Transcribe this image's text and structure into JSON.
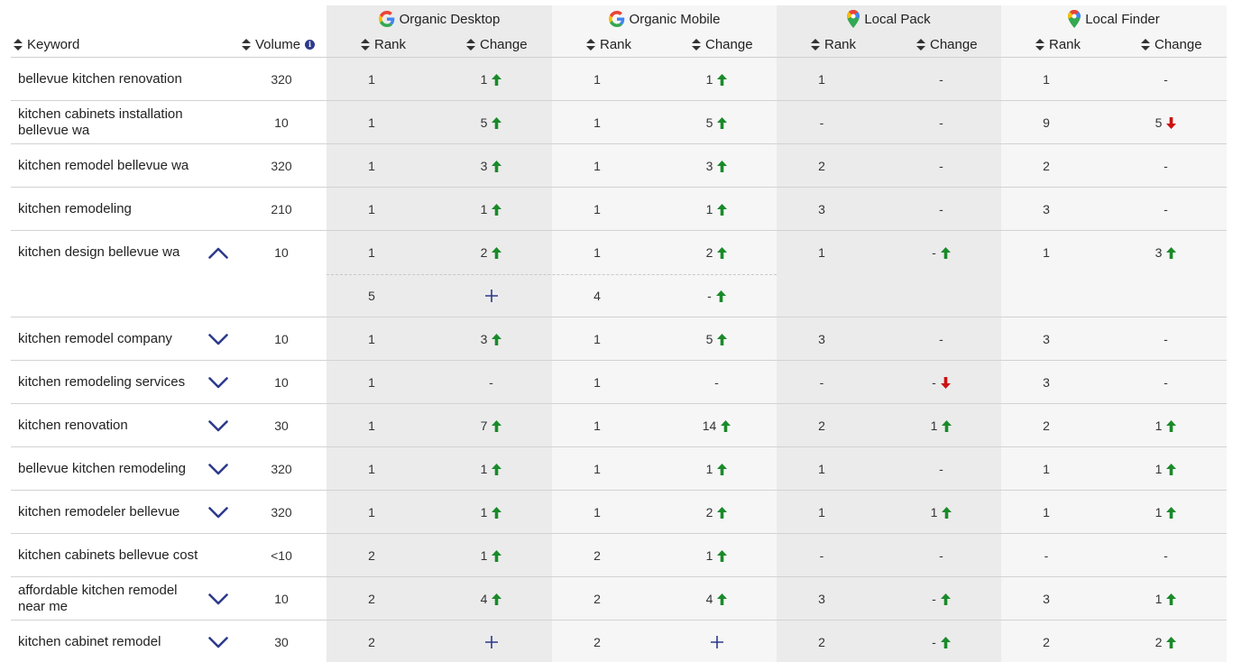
{
  "groups": {
    "organic_desktop": "Organic Desktop",
    "organic_mobile": "Organic Mobile",
    "local_pack": "Local Pack",
    "local_finder": "Local Finder"
  },
  "columns": {
    "keyword": "Keyword",
    "volume": "Volume",
    "rank": "Rank",
    "change": "Change"
  },
  "colors": {
    "up": "#1a8a2a",
    "down": "#cc1111",
    "accent": "#2d3a8c"
  },
  "icons": {
    "sort": "sort-icon",
    "info": "info-icon",
    "google": "google-icon",
    "maps_pin": "maps-pin-icon",
    "chevron_up": "chevron-up-icon",
    "chevron_down": "chevron-down-icon",
    "arrow_up": "arrow-up-icon",
    "arrow_down": "arrow-down-icon",
    "plus": "plus-icon"
  },
  "rows": [
    {
      "keyword": "bellevue kitchen renovation",
      "expander": "",
      "volume": "320",
      "od_rank": "1",
      "od_change": "1",
      "od_dir": "up",
      "om_rank": "1",
      "om_change": "1",
      "om_dir": "up",
      "lp_rank": "1",
      "lp_change": "-",
      "lp_dir": "",
      "lf_rank": "1",
      "lf_change": "-",
      "lf_dir": ""
    },
    {
      "keyword": "kitchen cabinets installation bellevue wa",
      "expander": "",
      "volume": "10",
      "od_rank": "1",
      "od_change": "5",
      "od_dir": "up",
      "om_rank": "1",
      "om_change": "5",
      "om_dir": "up",
      "lp_rank": "-",
      "lp_change": "-",
      "lp_dir": "",
      "lf_rank": "9",
      "lf_change": "5",
      "lf_dir": "down"
    },
    {
      "keyword": "kitchen remodel bellevue wa",
      "expander": "",
      "volume": "320",
      "od_rank": "1",
      "od_change": "3",
      "od_dir": "up",
      "om_rank": "1",
      "om_change": "3",
      "om_dir": "up",
      "lp_rank": "2",
      "lp_change": "-",
      "lp_dir": "",
      "lf_rank": "2",
      "lf_change": "-",
      "lf_dir": ""
    },
    {
      "keyword": "kitchen remodeling",
      "expander": "",
      "volume": "210",
      "od_rank": "1",
      "od_change": "1",
      "od_dir": "up",
      "om_rank": "1",
      "om_change": "1",
      "om_dir": "up",
      "lp_rank": "3",
      "lp_change": "-",
      "lp_dir": "",
      "lf_rank": "3",
      "lf_change": "-",
      "lf_dir": ""
    },
    {
      "keyword": "kitchen design bellevue wa",
      "expander": "up",
      "volume": "10",
      "od_rank": "1",
      "od_change": "2",
      "od_dir": "up",
      "om_rank": "1",
      "om_change": "2",
      "om_dir": "up",
      "lp_rank": "1",
      "lp_change": "-",
      "lp_dir": "up",
      "lf_rank": "1",
      "lf_change": "3",
      "lf_dir": "up",
      "sub": {
        "od_rank": "5",
        "od_change": "",
        "od_dir": "plus",
        "om_rank": "4",
        "om_change": "-",
        "om_dir": "up"
      }
    },
    {
      "keyword": "kitchen remodel company",
      "expander": "down",
      "volume": "10",
      "od_rank": "1",
      "od_change": "3",
      "od_dir": "up",
      "om_rank": "1",
      "om_change": "5",
      "om_dir": "up",
      "lp_rank": "3",
      "lp_change": "-",
      "lp_dir": "",
      "lf_rank": "3",
      "lf_change": "-",
      "lf_dir": ""
    },
    {
      "keyword": "kitchen remodeling services",
      "expander": "down",
      "volume": "10",
      "od_rank": "1",
      "od_change": "-",
      "od_dir": "",
      "om_rank": "1",
      "om_change": "-",
      "om_dir": "",
      "lp_rank": "-",
      "lp_change": "-",
      "lp_dir": "down",
      "lf_rank": "3",
      "lf_change": "-",
      "lf_dir": ""
    },
    {
      "keyword": "kitchen renovation",
      "expander": "down",
      "volume": "30",
      "od_rank": "1",
      "od_change": "7",
      "od_dir": "up",
      "om_rank": "1",
      "om_change": "14",
      "om_dir": "up",
      "lp_rank": "2",
      "lp_change": "1",
      "lp_dir": "up",
      "lf_rank": "2",
      "lf_change": "1",
      "lf_dir": "up"
    },
    {
      "keyword": "bellevue kitchen remodeling",
      "expander": "down",
      "volume": "320",
      "od_rank": "1",
      "od_change": "1",
      "od_dir": "up",
      "om_rank": "1",
      "om_change": "1",
      "om_dir": "up",
      "lp_rank": "1",
      "lp_change": "-",
      "lp_dir": "",
      "lf_rank": "1",
      "lf_change": "1",
      "lf_dir": "up"
    },
    {
      "keyword": "kitchen remodeler bellevue",
      "expander": "down",
      "volume": "320",
      "od_rank": "1",
      "od_change": "1",
      "od_dir": "up",
      "om_rank": "1",
      "om_change": "2",
      "om_dir": "up",
      "lp_rank": "1",
      "lp_change": "1",
      "lp_dir": "up",
      "lf_rank": "1",
      "lf_change": "1",
      "lf_dir": "up"
    },
    {
      "keyword": "kitchen cabinets bellevue cost",
      "expander": "",
      "volume": "<10",
      "od_rank": "2",
      "od_change": "1",
      "od_dir": "up",
      "om_rank": "2",
      "om_change": "1",
      "om_dir": "up",
      "lp_rank": "-",
      "lp_change": "-",
      "lp_dir": "",
      "lf_rank": "-",
      "lf_change": "-",
      "lf_dir": ""
    },
    {
      "keyword": "affordable kitchen remodel near me",
      "expander": "down",
      "volume": "10",
      "od_rank": "2",
      "od_change": "4",
      "od_dir": "up",
      "om_rank": "2",
      "om_change": "4",
      "om_dir": "up",
      "lp_rank": "3",
      "lp_change": "-",
      "lp_dir": "up",
      "lf_rank": "3",
      "lf_change": "1",
      "lf_dir": "up"
    },
    {
      "keyword": "kitchen cabinet remodel",
      "expander": "down",
      "volume": "30",
      "od_rank": "2",
      "od_change": "",
      "od_dir": "plus",
      "om_rank": "2",
      "om_change": "",
      "om_dir": "plus",
      "lp_rank": "2",
      "lp_change": "-",
      "lp_dir": "up",
      "lf_rank": "2",
      "lf_change": "2",
      "lf_dir": "up"
    }
  ]
}
